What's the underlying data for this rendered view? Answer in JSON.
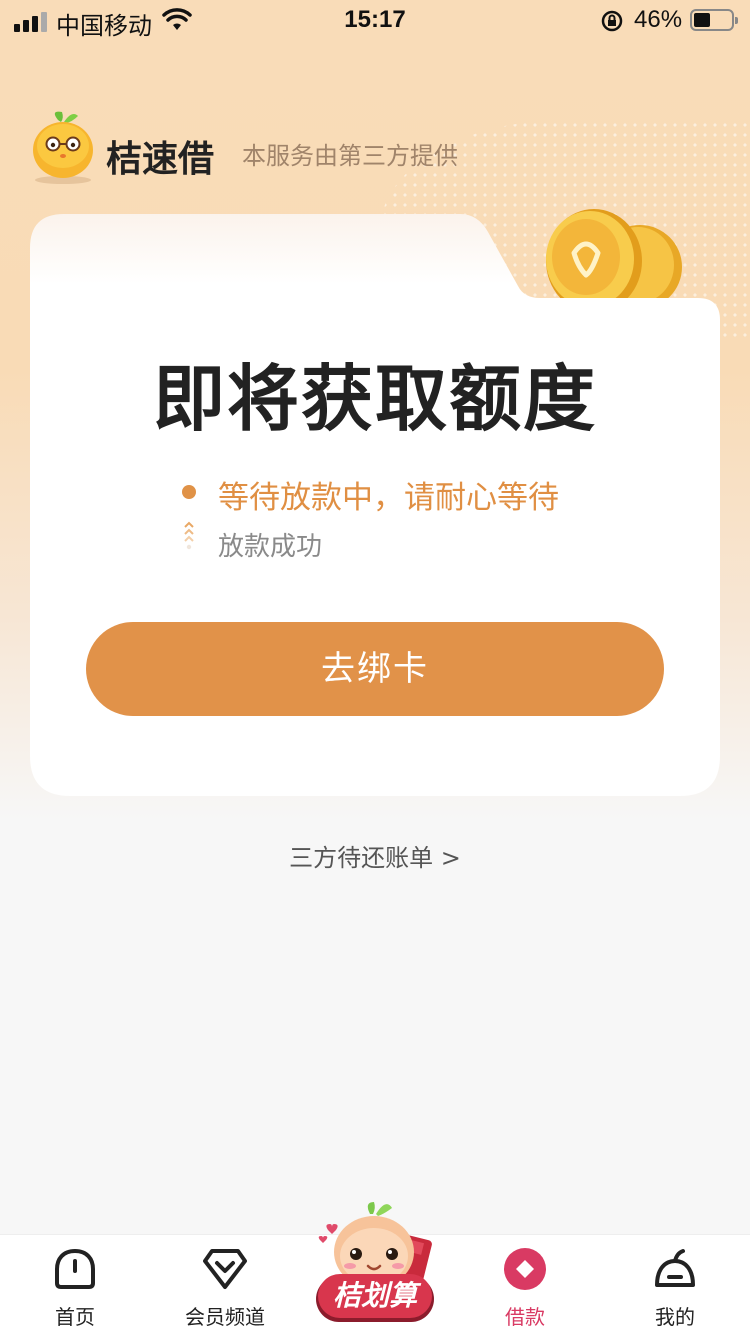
{
  "status_bar": {
    "carrier": "中国移动",
    "time": "15:17",
    "battery_percent": "46%"
  },
  "brand": {
    "name": "桔速借",
    "note": "本服务由第三方提供"
  },
  "card": {
    "title": "即将获取额度",
    "steps": [
      {
        "label": "等待放款中，请耐心等待",
        "active": true
      },
      {
        "label": "放款成功",
        "active": false
      }
    ],
    "button_label": "去绑卡"
  },
  "bill_link": "三方待还账单 >",
  "tabbar": {
    "items": [
      {
        "label": "首页",
        "icon": "home-icon"
      },
      {
        "label": "会员频道",
        "icon": "member-icon"
      },
      {
        "label": "桔划算",
        "icon": "promo-mascot-icon"
      },
      {
        "label": "借款",
        "icon": "loan-icon",
        "active": true
      },
      {
        "label": "我的",
        "icon": "profile-icon"
      }
    ]
  },
  "colors": {
    "accent": "#e19249",
    "active_tab": "#d93a63",
    "background_top": "#f9dcb8"
  }
}
